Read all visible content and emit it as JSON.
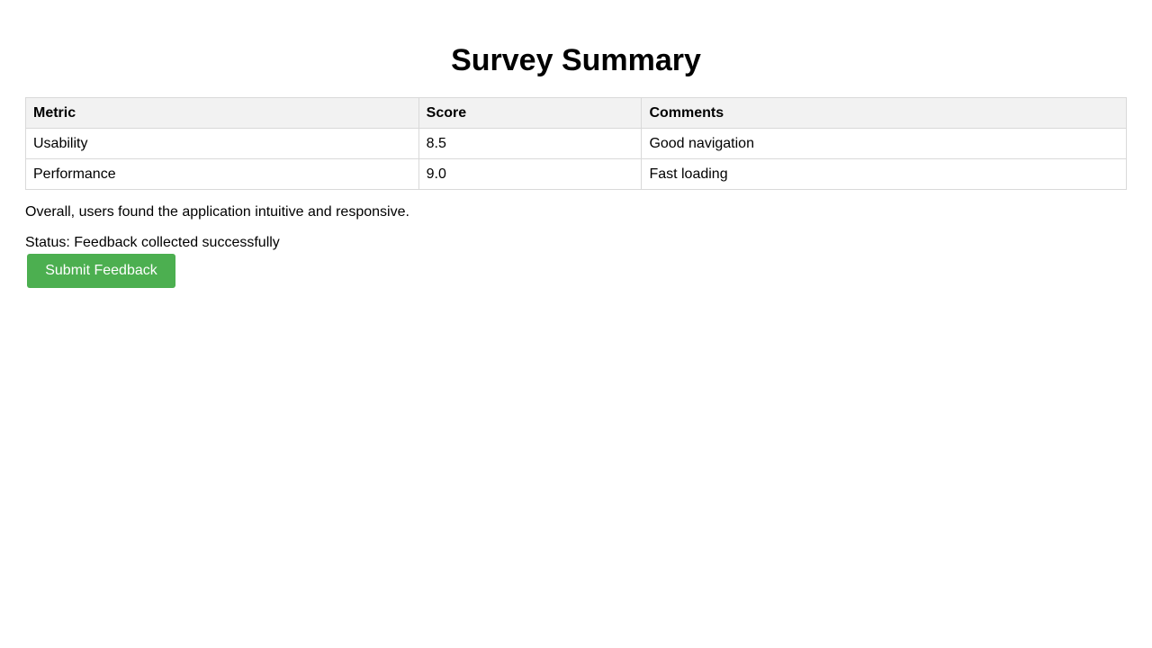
{
  "page": {
    "title": "Survey Summary"
  },
  "table": {
    "headers": [
      "Metric",
      "Score",
      "Comments"
    ],
    "rows": [
      [
        "Usability",
        "8.5",
        "Good navigation"
      ],
      [
        "Performance",
        "9.0",
        "Fast loading"
      ]
    ]
  },
  "summary_text": "Overall, users found the application intuitive and responsive.",
  "status_text": "Status: Feedback collected successfully",
  "actions": {
    "submit_label": "Submit Feedback"
  },
  "colors": {
    "button_bg": "#4caf50",
    "header_bg": "#f2f2f2",
    "border": "#d9d9d9"
  }
}
